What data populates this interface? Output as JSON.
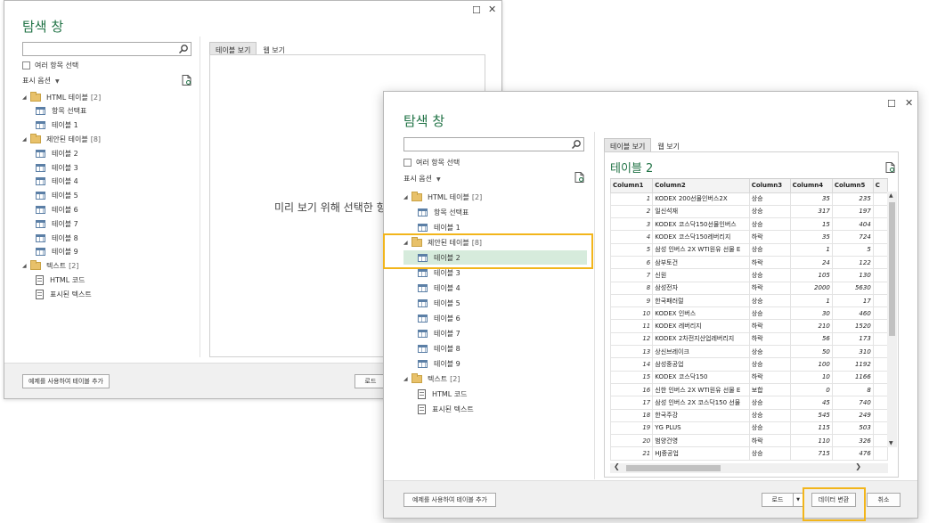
{
  "back": {
    "title": "탐색 창",
    "search_placeholder": "",
    "multi_select": "여러 항목 선택",
    "display_options": "표시 옵션",
    "tabs": [
      "테이블 보기",
      "웹 보기"
    ],
    "tree": [
      {
        "kind": "folder",
        "label": "HTML 테이블",
        "count": "[2]"
      },
      {
        "kind": "table",
        "label": "항목 선택표"
      },
      {
        "kind": "table",
        "label": "테이블 1"
      },
      {
        "kind": "folder",
        "label": "제안된 테이블",
        "count": "[8]"
      },
      {
        "kind": "table",
        "label": "테이블 2"
      },
      {
        "kind": "table",
        "label": "테이블 3"
      },
      {
        "kind": "table",
        "label": "테이블 4"
      },
      {
        "kind": "table",
        "label": "테이블 5"
      },
      {
        "kind": "table",
        "label": "테이블 6"
      },
      {
        "kind": "table",
        "label": "테이블 7"
      },
      {
        "kind": "table",
        "label": "테이블 8"
      },
      {
        "kind": "table",
        "label": "테이블 9"
      },
      {
        "kind": "folder",
        "label": "텍스트",
        "count": "[2]"
      },
      {
        "kind": "text",
        "label": "HTML 코드"
      },
      {
        "kind": "text",
        "label": "표시된 텍스트"
      }
    ],
    "preview_message": "미리 보기 위해 선택한 항",
    "add_table_button": "예제를 사용하여 테이블 추가",
    "load_button": "로드"
  },
  "front": {
    "title": "탐색 창",
    "search_placeholder": "",
    "multi_select": "여러 항목 선택",
    "display_options": "표시 옵션",
    "tabs": [
      "테이블 보기",
      "웹 보기"
    ],
    "tree": [
      {
        "kind": "folder",
        "label": "HTML 테이블",
        "count": "[2]"
      },
      {
        "kind": "table",
        "label": "항목 선택표"
      },
      {
        "kind": "table",
        "label": "테이블 1"
      },
      {
        "kind": "folder",
        "label": "제안된 테이블",
        "count": "[8]"
      },
      {
        "kind": "table",
        "label": "테이블 2"
      },
      {
        "kind": "table",
        "label": "테이블 3"
      },
      {
        "kind": "table",
        "label": "테이블 4"
      },
      {
        "kind": "table",
        "label": "테이블 5"
      },
      {
        "kind": "table",
        "label": "테이블 6"
      },
      {
        "kind": "table",
        "label": "테이블 7"
      },
      {
        "kind": "table",
        "label": "테이블 8"
      },
      {
        "kind": "table",
        "label": "테이블 9"
      },
      {
        "kind": "folder",
        "label": "텍스트",
        "count": "[2]"
      },
      {
        "kind": "text",
        "label": "HTML 코드"
      },
      {
        "kind": "text",
        "label": "표시된 텍스트"
      }
    ],
    "selected_label": "테이블 2",
    "grid_title": "테이블 2",
    "columns": [
      "Column1",
      "Column2",
      "Column3",
      "Column4",
      "Column5",
      "C"
    ],
    "rows": [
      [
        "1",
        "KODEX 200선물인버스2X",
        "상승",
        "35",
        "235"
      ],
      [
        "2",
        "일신석재",
        "상승",
        "317",
        "197"
      ],
      [
        "3",
        "KODEX 코스닥150선물인버스",
        "상승",
        "15",
        "404"
      ],
      [
        "4",
        "KODEX 코스닥150레버리지",
        "하락",
        "35",
        "724"
      ],
      [
        "5",
        "삼성 인버스 2X WTI원유 선물 E",
        "상승",
        "1",
        "5"
      ],
      [
        "6",
        "삼부토건",
        "하락",
        "24",
        "122"
      ],
      [
        "7",
        "신원",
        "상승",
        "105",
        "130"
      ],
      [
        "8",
        "삼성전자",
        "하락",
        "2000",
        "5630"
      ],
      [
        "9",
        "한국패러럴",
        "상승",
        "1",
        "17"
      ],
      [
        "10",
        "KODEX 인버스",
        "상승",
        "30",
        "460"
      ],
      [
        "11",
        "KODEX 레버리지",
        "하락",
        "210",
        "1520"
      ],
      [
        "12",
        "KODEX 2차전지산업레버리지",
        "하락",
        "56",
        "173"
      ],
      [
        "13",
        "상신브레이크",
        "상승",
        "50",
        "310"
      ],
      [
        "14",
        "삼성중공업",
        "상승",
        "100",
        "1192"
      ],
      [
        "15",
        "KODEX 코스닥150",
        "하락",
        "10",
        "1166"
      ],
      [
        "16",
        "신한 인버스 2X WTI원유 선물 E",
        "보합",
        "0",
        "8"
      ],
      [
        "17",
        "삼성 인버스 2X 코스닥150 선물",
        "상승",
        "45",
        "740"
      ],
      [
        "18",
        "한국주강",
        "상승",
        "545",
        "249"
      ],
      [
        "19",
        "YG PLUS",
        "상승",
        "115",
        "503"
      ],
      [
        "20",
        "범양건영",
        "하락",
        "110",
        "326"
      ],
      [
        "21",
        "HJ중공업",
        "상승",
        "715",
        "476"
      ]
    ],
    "add_table_button": "예제를 사용하여 테이블 추가",
    "load_button": "로드",
    "transform_button": "데이터 변환",
    "cancel_button": "취소"
  },
  "colors": {
    "accent": "#217346",
    "highlight": "#f2b51b",
    "selected_bg": "#d6ebdc"
  }
}
